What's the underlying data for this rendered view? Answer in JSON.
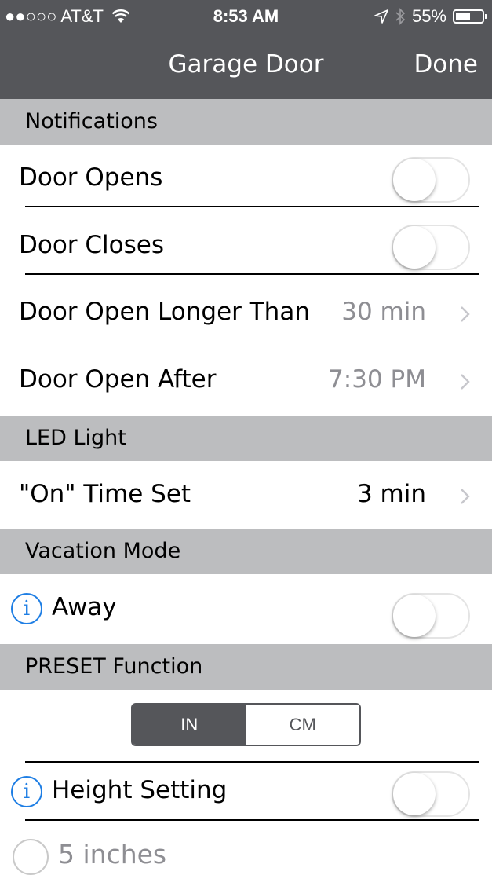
{
  "status_bar": {
    "carrier": "●●○○○ AT&T",
    "time": "8:53 AM",
    "battery_text": "55%",
    "battery_level": 0.55
  },
  "nav": {
    "title": "Garage Door",
    "done_label": "Done"
  },
  "notifications": {
    "header": "Notifications",
    "door_opens": {
      "label": "Door Opens",
      "on": false
    },
    "door_closes": {
      "label": "Door Closes",
      "on": false
    },
    "open_longer": {
      "label": "Door Open Longer Than",
      "value": "30 min"
    },
    "open_after": {
      "label": "Door Open After",
      "value": "7:30 PM"
    }
  },
  "led_light": {
    "header": "LED Light",
    "on_time": {
      "label": "\"On\" Time Set",
      "value": "3 min"
    }
  },
  "vacation": {
    "header": "Vacation Mode",
    "away": {
      "label": "Away",
      "on": false,
      "info_glyph": "i"
    }
  },
  "preset": {
    "header": "PRESET Function",
    "unit_options": [
      "IN",
      "CM"
    ],
    "selected_unit": "IN",
    "height_setting": {
      "label": "Height Setting",
      "on": false,
      "info_glyph": "i"
    },
    "height_option": {
      "label": "5 inches",
      "selected": false
    }
  },
  "colors": {
    "bar_bg": "#55565a",
    "section_bg": "#bcbdbf",
    "info_blue": "#1e7ee4",
    "secondary_text": "#8e8e93"
  },
  "icons": [
    "wifi-icon",
    "location-arrow-icon",
    "bluetooth-icon",
    "battery-icon",
    "chevron-right-icon",
    "info-icon",
    "radio-button-icon"
  ]
}
